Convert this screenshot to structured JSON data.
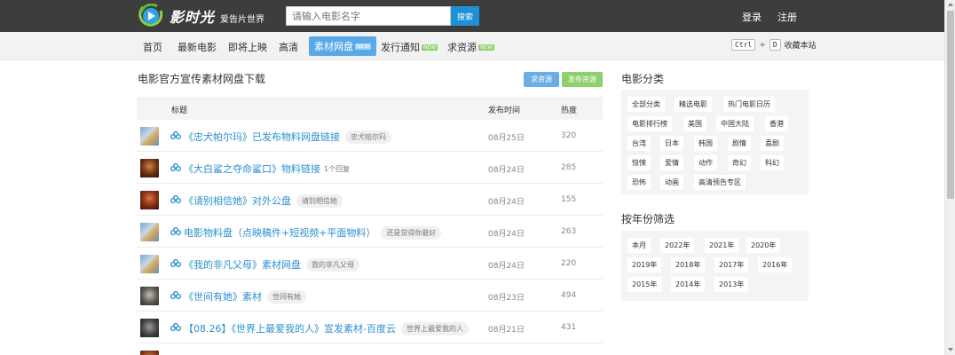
{
  "header": {
    "logo_name": "影时光",
    "logo_slogan": "爱告片世界",
    "search_placeholder": "请输入电影名字",
    "search_button": "搜索",
    "login": "登录",
    "register": "注册"
  },
  "nav": {
    "items": [
      {
        "label": "首页"
      },
      {
        "label": "最新电影"
      },
      {
        "label": "即将上映"
      },
      {
        "label": "高清"
      },
      {
        "label": "素材网盘",
        "badge": "NEW"
      },
      {
        "label": "发行通知",
        "badge": "NEW"
      },
      {
        "label": "求资源",
        "badge": "NEW"
      }
    ],
    "shortcut": {
      "key1": "Ctrl",
      "plus": "+",
      "key2": "D",
      "label": "收藏本站"
    }
  },
  "main": {
    "title": "电影官方宣传素材网盘下载",
    "ask_button": "求资源",
    "post_button": "发布资源",
    "columns": {
      "title": "标题",
      "date": "发布时间",
      "heat": "热度"
    },
    "rows": [
      {
        "title": "《忠犬帕尔玛》已发布物料网盘链接",
        "tag": "忠犬帕尔玛",
        "date": "08月25日",
        "heat": "320"
      },
      {
        "title": "《大白鲨之夺命鲨口》物料链接",
        "reply": "1个回复",
        "date": "08月24日",
        "heat": "285"
      },
      {
        "title": "《请别相信她》对外公盘",
        "tag": "请别相信她",
        "date": "08月24日",
        "heat": "155"
      },
      {
        "title": "电影物料盘（点映稿件+短视频+平面物料）",
        "tag": "还是觉得你最好",
        "date": "08月24日",
        "heat": "263"
      },
      {
        "title": "《我的非凡父母》素材网盘",
        "tag": "我的非凡父母",
        "date": "08月24日",
        "heat": "220"
      },
      {
        "title": "《世间有她》素材",
        "tag": "世间有她",
        "date": "08月23日",
        "heat": "494"
      },
      {
        "title": "【08.26】《世界上最爱我的人》宣发素材-百度云",
        "tag": "世界上最爱我的人",
        "date": "08月21日",
        "heat": "431"
      }
    ]
  },
  "sidebar": {
    "category_title": "电影分类",
    "categories": [
      "全部分类",
      "精选电影",
      "热门电影日历",
      "电影排行榜",
      "美国",
      "中国大陆",
      "香港",
      "台湾",
      "日本",
      "韩国",
      "剧情",
      "喜剧",
      "惊悚",
      "爱情",
      "动作",
      "奇幻",
      "科幻",
      "恐怖",
      "动画",
      "高清预告专区"
    ],
    "year_title": "按年份筛选",
    "years": [
      "本月",
      "2022年",
      "2021年",
      "2020年",
      "2019年",
      "2018年",
      "2017年",
      "2016年",
      "2015年",
      "2014年",
      "2013年"
    ]
  }
}
